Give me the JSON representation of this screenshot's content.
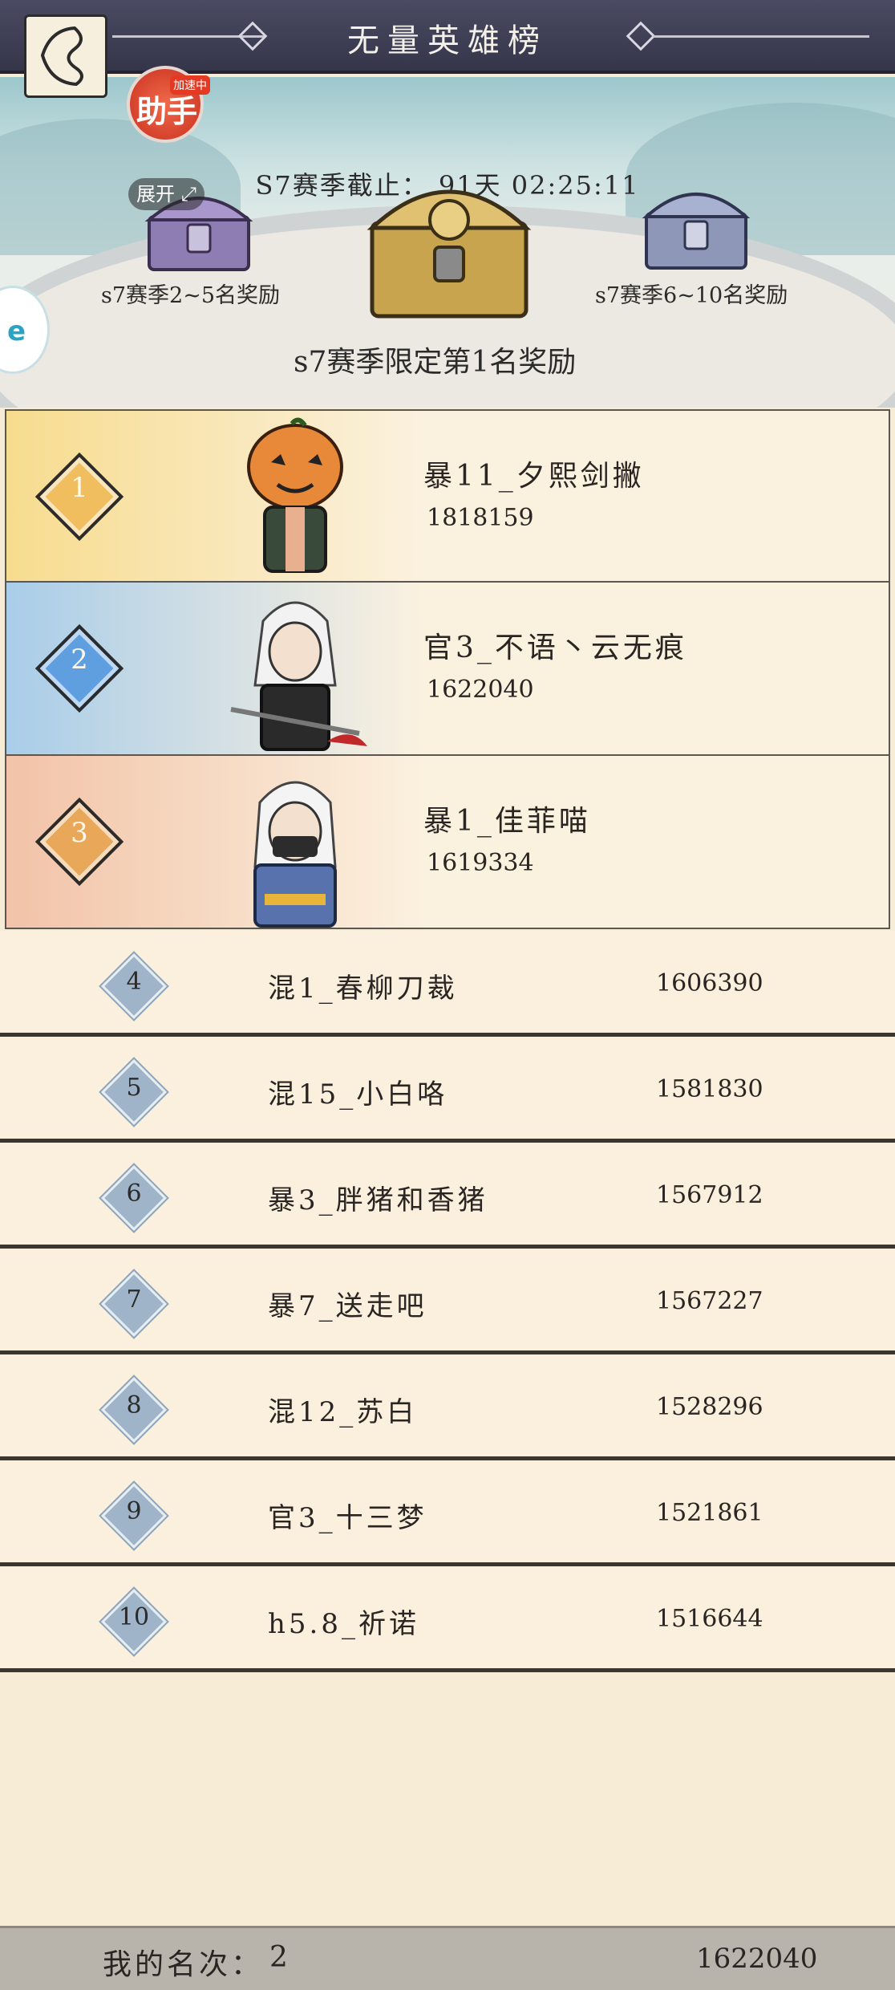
{
  "header": {
    "title": "无量英雄榜"
  },
  "banner": {
    "countdown": "S7赛季截止： 91天  02:25:11",
    "chest_left_label": "s7赛季2~5名奖励",
    "chest_right_label": "s7赛季6~10名奖励",
    "chest_main_label": "s7赛季限定第1名奖励",
    "speed_badge_text": "助手",
    "speed_badge_tag": "加速中",
    "expand_label": "展开",
    "side_tab_text": "e"
  },
  "top_three": [
    {
      "rank": "1",
      "name": "暴11_夕熙剑撇",
      "score": "1818159",
      "color": "#f6d987"
    },
    {
      "rank": "2",
      "name": "官3_不语丶云无痕",
      "score": "1622040",
      "color": "#a9cde9"
    },
    {
      "rank": "3",
      "name": "暴1_佳菲喵",
      "score": "1619334",
      "color": "#f2c3a8"
    }
  ],
  "ranks": [
    {
      "rank": "4",
      "name": "混1_春柳刀裁",
      "score": "1606390"
    },
    {
      "rank": "5",
      "name": "混15_小白咯",
      "score": "1581830"
    },
    {
      "rank": "6",
      "name": "暴3_胖猪和香猪",
      "score": "1567912"
    },
    {
      "rank": "7",
      "name": "暴7_送走吧",
      "score": "1567227"
    },
    {
      "rank": "8",
      "name": "混12_苏白",
      "score": "1528296"
    },
    {
      "rank": "9",
      "name": "官3_十三梦",
      "score": "1521861"
    },
    {
      "rank": "10",
      "name": "h5.8_祈诺",
      "score": "1516644"
    }
  ],
  "footer": {
    "label": "我的名次：",
    "rank": "2",
    "score": "1622040"
  }
}
